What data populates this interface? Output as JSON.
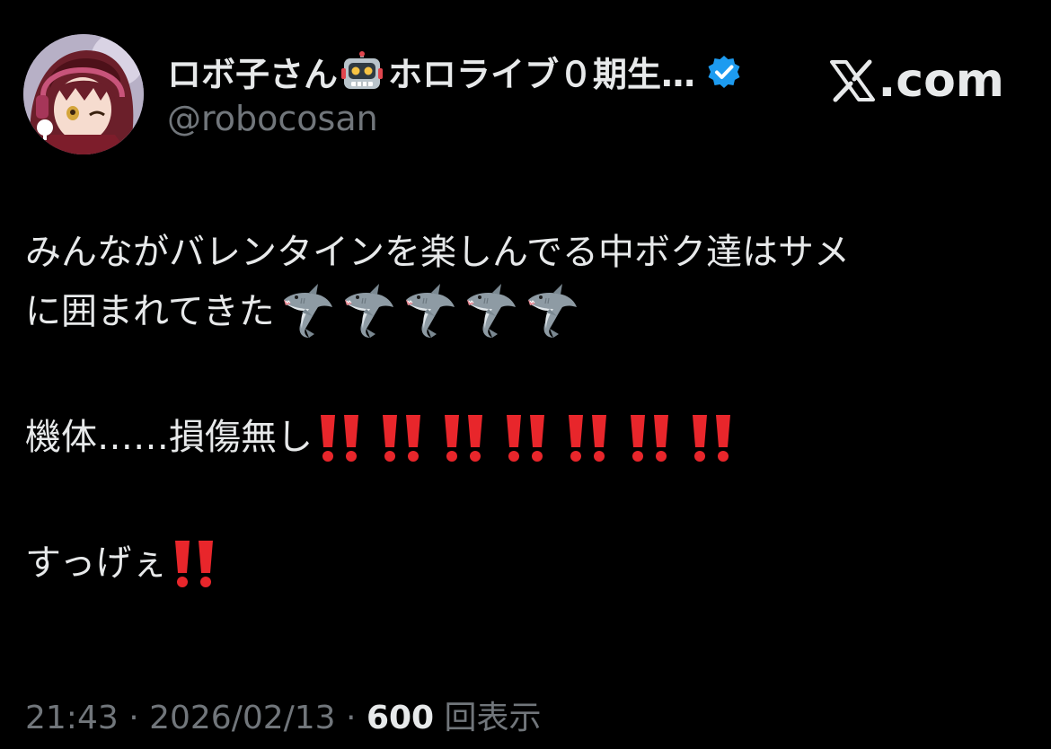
{
  "profile": {
    "display_name": "ロボ子さん",
    "display_name_suffix": "ホロライブ０期生…",
    "handle": "@robocosan",
    "name_emoji": "robot-face-icon",
    "verified_icon": "verified-badge-icon",
    "verified_color": "#1d9bf0"
  },
  "source": {
    "label": ".com",
    "logo_icon": "x-logo-icon"
  },
  "tweet": {
    "line1": "みんながバレンタインを楽しんでる中ボク達はサメ",
    "line2": "に囲まれてきた",
    "line2_emoji": [
      "shark-icon",
      "shark-icon",
      "shark-icon",
      "shark-icon",
      "shark-icon"
    ],
    "line3": "機体……損傷無し",
    "line3_emoji": [
      "double-exclamation-icon",
      "double-exclamation-icon",
      "double-exclamation-icon",
      "double-exclamation-icon",
      "double-exclamation-icon",
      "double-exclamation-icon",
      "double-exclamation-icon"
    ],
    "line4": "すっげぇ",
    "line4_emoji": [
      "double-exclamation-icon"
    ]
  },
  "meta": {
    "time": "21:43",
    "separator": " · ",
    "date": "2026/02/13",
    "views_count": "600",
    "views_label": "回表示"
  },
  "colors": {
    "background": "#000000",
    "text": "#e7e9ea",
    "secondary_text": "#71767b",
    "exclamation_red": "#e8262b"
  }
}
